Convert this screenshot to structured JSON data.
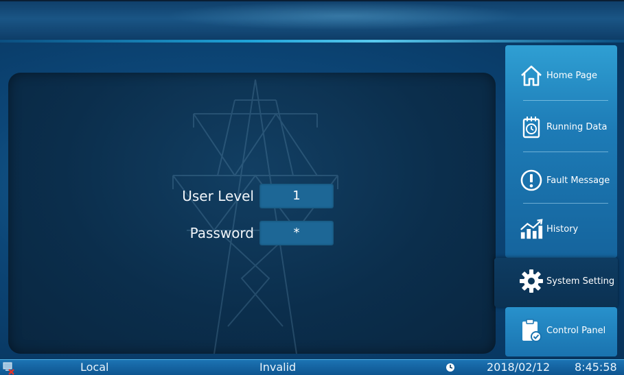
{
  "form": {
    "user_level_label": "User Level",
    "user_level_value": "1",
    "password_label": "Password",
    "password_value": "*"
  },
  "nav": {
    "items": [
      {
        "label": "Home Page",
        "icon": "home-icon"
      },
      {
        "label": "Running Data",
        "icon": "calendar-clock-icon"
      },
      {
        "label": "Fault Message",
        "icon": "exclamation-icon"
      },
      {
        "label": "History",
        "icon": "chart-icon"
      },
      {
        "label": "System Setting",
        "icon": "gear-icon",
        "selected": true
      },
      {
        "label": "Control Panel",
        "icon": "clipboard-check-icon"
      }
    ]
  },
  "status": {
    "mode": "Local",
    "state": "Invalid",
    "date": "2018/02/12",
    "time": "8:45:58"
  },
  "colors": {
    "accent": "#1fa3d8",
    "field": "#1d6796",
    "nav": "#1d7bb6"
  }
}
